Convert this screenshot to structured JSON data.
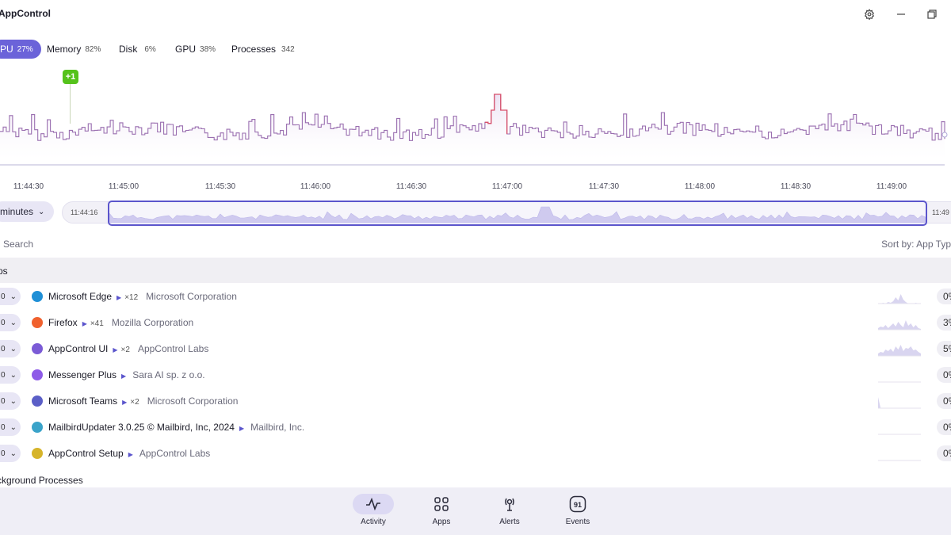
{
  "app": {
    "title": "AppControl"
  },
  "tabs": [
    {
      "label": "PU",
      "value": "27%",
      "active": true
    },
    {
      "label": "Memory",
      "value": "82%"
    },
    {
      "label": "Disk",
      "value": "6%"
    },
    {
      "label": "GPU",
      "value": "38%"
    },
    {
      "label": "Processes",
      "value": "342"
    }
  ],
  "chart": {
    "marker_label": "+1",
    "time_labels": [
      "11:44:30",
      "11:45:00",
      "11:45:30",
      "11:46:00",
      "11:46:30",
      "11:47:00",
      "11:47:30",
      "11:48:00",
      "11:48:30",
      "11:49:00"
    ],
    "line_color": "#9a6fb0",
    "peak_color": "#d9506a"
  },
  "range": {
    "select_label": "minutes",
    "start_time": "11:44:16",
    "end_time": "11:49"
  },
  "list": {
    "search_placeholder": "Search",
    "sort_label": "Sort by: App Typ",
    "group_label": "ps",
    "background_label": "ckground Processes",
    "apps": [
      {
        "name": "Microsoft Edge",
        "count": "×12",
        "vendor": "Microsoft Corporation",
        "value": "0%",
        "toggle": "0",
        "icon": "edge-icon",
        "color": "#1f8fd6"
      },
      {
        "name": "Firefox",
        "count": "×41",
        "vendor": "Mozilla Corporation",
        "value": "3%",
        "toggle": "0",
        "icon": "firefox-icon",
        "color": "#f0612e"
      },
      {
        "name": "AppControl UI",
        "count": "×2",
        "vendor": "AppControl Labs",
        "value": "5%",
        "toggle": "0",
        "icon": "appcontrol-icon",
        "color": "#7b5bd6"
      },
      {
        "name": "Messenger Plus",
        "count": "",
        "vendor": "Sara AI sp. z o.o.",
        "value": "0%",
        "toggle": "0",
        "icon": "messenger-icon",
        "color": "#8e5be8"
      },
      {
        "name": "Microsoft Teams",
        "count": "×2",
        "vendor": "Microsoft Corporation",
        "value": "0%",
        "toggle": "0",
        "icon": "teams-icon",
        "color": "#5b5fc7"
      },
      {
        "name": "MailbirdUpdater 3.0.25 © Mailbird, Inc, 2024",
        "count": "",
        "vendor": "Mailbird, Inc.",
        "value": "0%",
        "toggle": "0",
        "icon": "mailbird-icon",
        "color": "#3aa3c9"
      },
      {
        "name": "AppControl Setup",
        "count": "",
        "vendor": "AppControl Labs",
        "value": "0%",
        "toggle": "0",
        "icon": "appcontrol-setup-icon",
        "color": "#d6b42a"
      }
    ]
  },
  "nav": [
    {
      "label": "Activity",
      "icon": "activity-icon",
      "active": true
    },
    {
      "label": "Apps",
      "icon": "apps-grid-icon"
    },
    {
      "label": "Alerts",
      "icon": "alerts-icon"
    },
    {
      "label": "Events",
      "icon": "events-icon",
      "badge": "91"
    }
  ]
}
